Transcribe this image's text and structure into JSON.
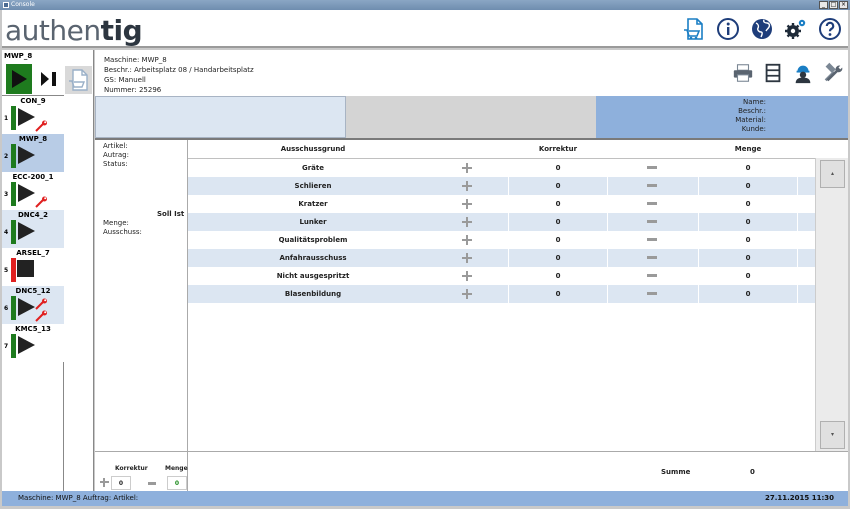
{
  "window": {
    "title": "Console"
  },
  "header": {
    "logo_light": "authen",
    "logo_bold": "tig"
  },
  "header_icons": [
    "document-cart-icon",
    "info-icon",
    "globe-icon",
    "settings-gear-icon",
    "help-icon"
  ],
  "current_machine": {
    "name": "MWP_8"
  },
  "machines": [
    {
      "num": "1",
      "name": "CON_9",
      "status_color": "#1e7b1e",
      "state": "play",
      "wrench": true,
      "wrench_count": 1
    },
    {
      "num": "2",
      "name": "MWP_8",
      "status_color": "#1e7b1e",
      "state": "play",
      "wrench": false,
      "wrench_count": 0
    },
    {
      "num": "3",
      "name": "ECC-200_1",
      "status_color": "#1e7b1e",
      "state": "play",
      "wrench": true,
      "wrench_count": 1
    },
    {
      "num": "4",
      "name": "DNC4_2",
      "status_color": "#1e7b1e",
      "state": "play",
      "wrench": false,
      "wrench_count": 0
    },
    {
      "num": "5",
      "name": "ARSEL_7",
      "status_color": "#e02020",
      "state": "stop",
      "wrench": false,
      "wrench_count": 0
    },
    {
      "num": "6",
      "name": "DNC5_12",
      "status_color": "#1e7b1e",
      "state": "play",
      "wrench": true,
      "wrench_count": 2
    },
    {
      "num": "7",
      "name": "KMC5_13",
      "status_color": "#1e7b1e",
      "state": "play",
      "wrench": false,
      "wrench_count": 0
    }
  ],
  "machine_info": {
    "maschine": "Maschine: MWP_8",
    "beschr": "Beschr.: Arbeitsplatz 08 / Handarbeitsplatz",
    "gs": "GS: Manuell",
    "nummer": "Nummer: 25296"
  },
  "toolbar_icons": [
    "printer-icon",
    "list-icon",
    "worker-icon",
    "tools-icon"
  ],
  "order_info": {
    "name_label": "Name:",
    "beschr_label": "Beschr.:",
    "material_label": "Material:",
    "kunde_label": "Kunde:"
  },
  "article": {
    "artikel": "Artikel:",
    "auftrag": "Autrag:",
    "status": "Status:",
    "soll_ist": "Soll Ist",
    "menge": "Menge:",
    "ausschuss": "Ausschuss:"
  },
  "table": {
    "headers": {
      "reason": "Ausschussgrund",
      "korrektur": "Korrektur",
      "menge": "Menge"
    },
    "rows": [
      {
        "reason": "Gräte",
        "korrektur": "0",
        "menge": "0"
      },
      {
        "reason": "Schlieren",
        "korrektur": "0",
        "menge": "0"
      },
      {
        "reason": "Kratzer",
        "korrektur": "0",
        "menge": "0"
      },
      {
        "reason": "Lunker",
        "korrektur": "0",
        "menge": "0"
      },
      {
        "reason": "Qualitätsproblem",
        "korrektur": "0",
        "menge": "0"
      },
      {
        "reason": "Anfahrausschuss",
        "korrektur": "0",
        "menge": "0"
      },
      {
        "reason": "Nicht ausgespritzt",
        "korrektur": "0",
        "menge": "0"
      },
      {
        "reason": "Blasenbildung",
        "korrektur": "0",
        "menge": "0"
      }
    ]
  },
  "korrektur_panel": {
    "korrektur_label": "Korrektur",
    "menge_label": "Menge",
    "korrektur_value": "0",
    "menge_value": "0"
  },
  "summe": {
    "label": "Summe",
    "value": "0"
  },
  "status_bar": {
    "left": "Maschine: MWP_8 Auftrag: Artikel:",
    "right": "27.11.2015 11:30"
  }
}
